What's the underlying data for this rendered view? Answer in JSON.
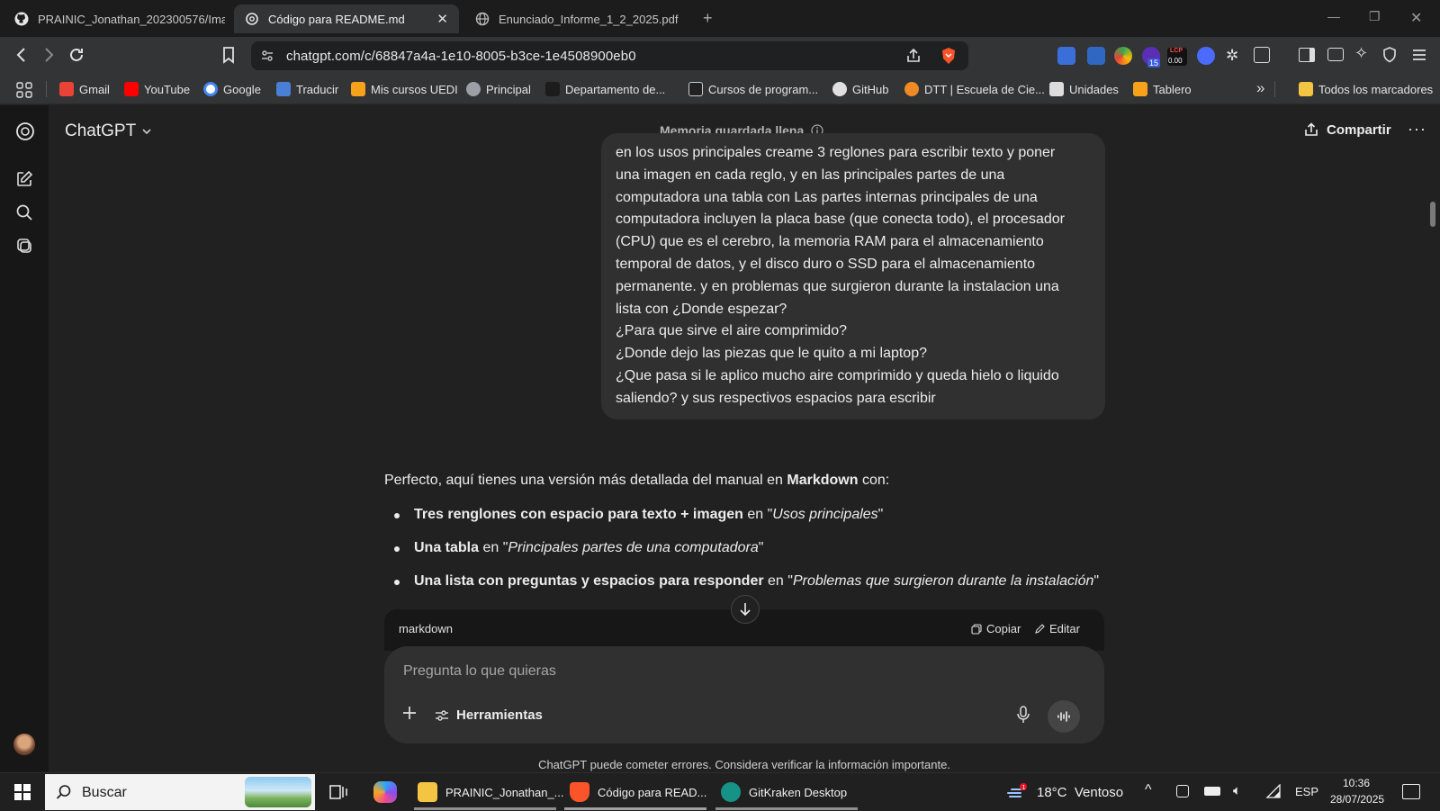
{
  "browser": {
    "tabs": [
      {
        "title": "PRAINIC_Jonathan_202300576/Imag",
        "icon": "github-icon"
      },
      {
        "title": "Código para README.md",
        "icon": "openai-icon",
        "active": true
      },
      {
        "title": "Enunciado_Informe_1_2_2025.pdf",
        "icon": "globe-icon"
      }
    ],
    "url": "chatgpt.com/c/68847a4a-1e10-8005-b3ce-1e4508900eb0",
    "extension_badges": {
      "count": "15",
      "lcp_label": "LCP",
      "lcp_value": "0.00"
    },
    "bookmarks": [
      {
        "label": "Gmail",
        "icon": "gmail-icon",
        "color": "#ea4335"
      },
      {
        "label": "YouTube",
        "icon": "youtube-icon",
        "color": "#ff0000"
      },
      {
        "label": "Google",
        "icon": "google-icon",
        "color": "#4285f4"
      },
      {
        "label": "Traducir",
        "icon": "translate-icon",
        "color": "#4a7fd6"
      },
      {
        "label": "Mis cursos UEDI",
        "icon": "moodle-icon",
        "color": "#f7a21b"
      },
      {
        "label": "Principal",
        "icon": "globe-icon",
        "color": "#9aa0a6"
      },
      {
        "label": "Departamento de...",
        "icon": "pen-icon",
        "color": "#1c1c1c"
      },
      {
        "label": "Cursos de program...",
        "icon": "course-icon",
        "color": "#222222"
      },
      {
        "label": "GitHub",
        "icon": "github-icon",
        "color": "#e0e0e0"
      },
      {
        "label": "DTT | Escuela de Cie...",
        "icon": "dtt-icon",
        "color": "#f08a24"
      },
      {
        "label": "Unidades",
        "icon": "unidades-icon",
        "color": "#dddddd"
      },
      {
        "label": "Tablero",
        "icon": "moodle-icon",
        "color": "#f7a21b"
      }
    ],
    "all_bookmarks": "Todos los marcadores"
  },
  "chat": {
    "model": "ChatGPT",
    "memory_status": "Memoria guardada llena",
    "share": "Compartir",
    "user_message": [
      "en los usos principales creame 3 reglones para escribir texto y poner",
      "una imagen en cada reglo, y en las principales partes de una",
      "computadora una tabla con Las partes internas principales de una",
      "computadora incluyen la placa base (que conecta todo), el procesador",
      "(CPU) que es el cerebro, la memoria RAM para el almacenamiento",
      "temporal de datos, y el disco duro o SSD para el almacenamiento",
      "permanente.  y en problemas que surgieron durante la instalacion una",
      "lista con ¿Donde espezar?",
      "¿Para que sirve el aire comprimido?",
      "¿Donde dejo las piezas que le quito a mi laptop?",
      "¿Que pasa si le aplico mucho aire comprimido y queda hielo o liquido",
      "saliendo? y sus respectivos espacios para escribir"
    ],
    "assistant_intro": {
      "before": "Perfecto, aquí tienes una versión más detallada del manual en ",
      "bold": "Markdown",
      "after": " con:"
    },
    "bullets": [
      {
        "bold": "Tres renglones con espacio para texto + imagen",
        "mid": " en \"",
        "italic": "Usos principales",
        "end": "\""
      },
      {
        "bold": "Una tabla",
        "mid": " en \"",
        "italic": "Principales partes de una computadora",
        "end": "\""
      },
      {
        "bold": "Una lista con preguntas y espacios para responder",
        "mid": " en \"",
        "italic": "Problemas que surgieron durante la instalación",
        "end": "\""
      }
    ],
    "code_block": {
      "language": "markdown",
      "copy": "Copiar",
      "edit": "Editar"
    },
    "composer": {
      "placeholder": "Pregunta lo que quieras",
      "tools": "Herramientas"
    },
    "disclaimer": "ChatGPT puede cometer errores. Considera verificar la información importante."
  },
  "taskbar": {
    "search": "Buscar",
    "apps": [
      {
        "label": "PRAINIC_Jonathan_...",
        "icon": "folder-icon",
        "color": "#f4c542"
      },
      {
        "label": "Código para READ...",
        "icon": "brave-icon",
        "color": "#fb542b"
      },
      {
        "label": "GitKraken Desktop",
        "icon": "gitkraken-icon",
        "color": "#179287"
      }
    ],
    "weather": "18°C  Ventoso",
    "language": "ESP",
    "time": "10:36",
    "date": "28/07/2025"
  },
  "colors": {
    "accent_brave": "#fb542b",
    "bubble": "#303030",
    "page": "#212121"
  }
}
